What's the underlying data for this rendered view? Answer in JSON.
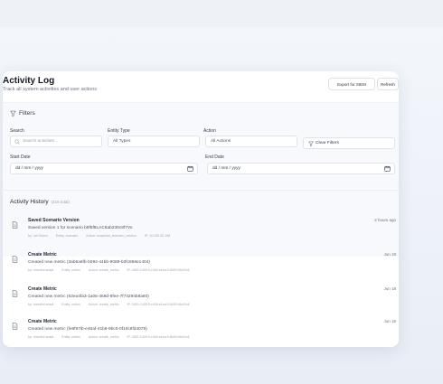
{
  "page": {
    "title": "Activity Log",
    "subtitle": "Track all system activities and user actions",
    "export_label": "Export for SIEM",
    "refresh_label": "Refresh"
  },
  "filters": {
    "title": "Filters",
    "search_label": "Search",
    "search_placeholder": "Search activities...",
    "entity_label": "Entity Type",
    "entity_value": "All Types",
    "action_label": "Action",
    "action_value": "All Actions",
    "clear_label": "Clear Filters",
    "start_label": "Start Date",
    "start_value": "dd / mm / yyyy",
    "end_label": "End Date",
    "end_value": "dd / mm / yyyy"
  },
  "history": {
    "title": "Activity History",
    "count": "(216 total)",
    "items": [
      {
        "title": "Saved Scenario Version",
        "desc": "Saved version 1 for scenario b9f5f8LAC6ab330c8f7Vo",
        "meta": [
          "by: Jai Shoen",
          "Entity: scenario",
          "Action: snapshot_scenario_version",
          "IP: 10.230.20.198"
        ],
        "time": "2 hours ago"
      },
      {
        "title": "Create Metric",
        "desc": "Created new metric (3ab6a6fb-b092-44bb-9089-b0fc858e1404)",
        "meta": [
          "by: meedinf.ansal",
          "Entity: metric",
          "Action: create_metric",
          "IP: 2601:1405:0:c40b:a1ea:0:8490:b6c5:b4"
        ],
        "time": "Jun 18"
      },
      {
        "title": "Create Metric",
        "desc": "Created new metric (63ea4fa3-1a06-469d-9fee-7f74294b8a60)",
        "meta": [
          "by: meedinf.ansal",
          "Entity: metric",
          "Action: create_metric",
          "IP: 2601:1405:0:c40b:a1ea:0:8490:b6c5:b4"
        ],
        "time": "Jun 18"
      },
      {
        "title": "Create Metric",
        "desc": "Created new metric (fe6f97ib-e46af-41b8-9bc0-0f10c8fd4079)",
        "meta": [
          "by: meedinf.ansal",
          "Entity: metric",
          "Action: create_metric",
          "IP: 2601:1405:0:c40b:a1ea:0:8490:b6c5:b4"
        ],
        "time": "Jun 18"
      }
    ]
  },
  "icons": {
    "filter": "filter-icon",
    "search": "search-icon",
    "calendar": "calendar-icon",
    "document": "document-icon"
  },
  "colors": {
    "background": "#eef2f7",
    "card": "#ffffff",
    "filters_panel": "#f7f9fc",
    "text_primary": "#1f2430",
    "text_muted": "#6b7280"
  }
}
